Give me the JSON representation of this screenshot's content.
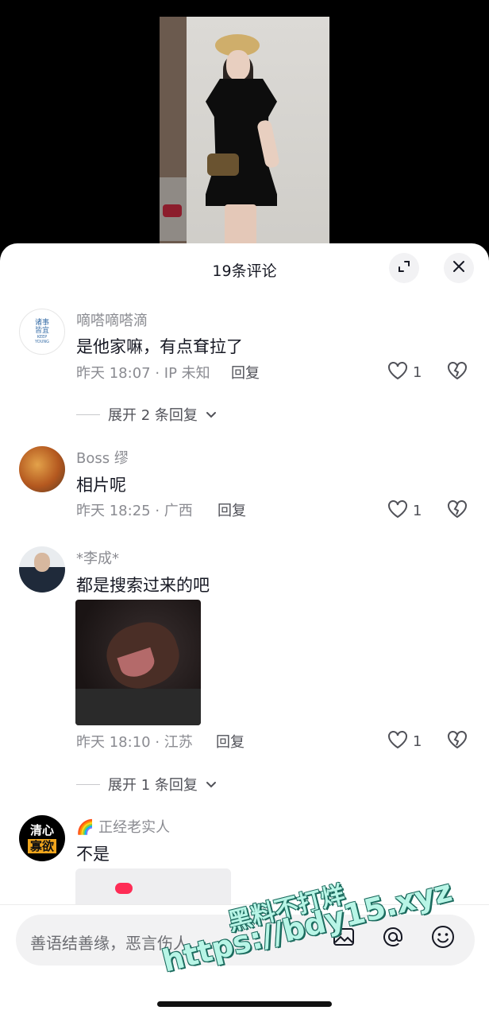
{
  "header": {
    "title": "19条评论"
  },
  "comments": [
    {
      "username": "嘀嗒嘀嗒滴",
      "text": "是他家嘛，有点耷拉了",
      "meta": "昨天 18:07 · IP 未知",
      "reply": "回复",
      "likes": "1",
      "expand": "展开 2 条回复",
      "avatar_text": "诸事\n皆宜",
      "avatar_sub": "KEEP\nYOUNG"
    },
    {
      "username": "Boss 缪",
      "text": "相片呢",
      "meta": "昨天 18:25 · 广西",
      "reply": "回复",
      "likes": "1"
    },
    {
      "username": "*李成*",
      "text": "都是搜索过来的吧",
      "meta": "昨天 18:10 · 江苏",
      "reply": "回复",
      "likes": "1",
      "expand": "展开 1 条回复"
    },
    {
      "username": "🌈 正经老实人",
      "text": "不是",
      "avatar_top": "清心",
      "avatar_bottom": "寡欲"
    }
  ],
  "input": {
    "placeholder": "善语结善缘，恶言伤人"
  },
  "watermark": {
    "line1": "黑料不打烊",
    "line2": "https://bdy15.xyz"
  },
  "colors": {
    "accent": "#fe2c55",
    "text": "#161823",
    "muted": "#8a8b91"
  },
  "icons": [
    "collapse-icon",
    "close-icon",
    "heart-icon",
    "broken-heart-icon",
    "chevron-down-icon",
    "image-icon",
    "at-icon",
    "emoji-icon"
  ]
}
